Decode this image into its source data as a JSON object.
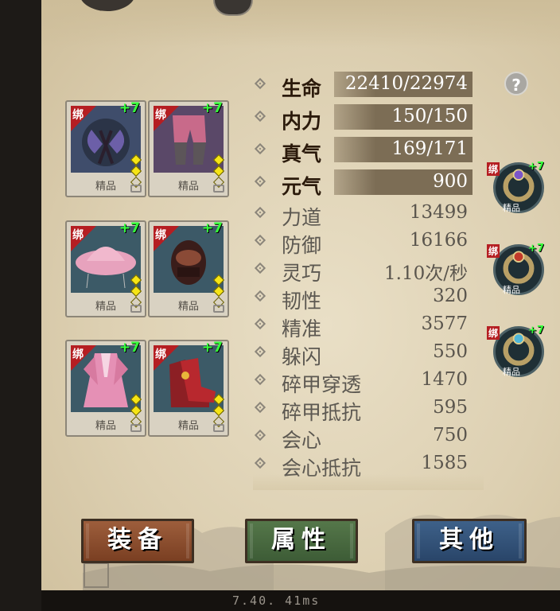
{
  "help_icon": "question-mark-icon",
  "equipment": {
    "bind_label": "绑",
    "slots": [
      {
        "plus": "+7",
        "quality": "精品",
        "item_icon": "twin-axe-weapon-icon",
        "accent": "#3f4d6b"
      },
      {
        "plus": "+7",
        "quality": "精品",
        "item_icon": "pink-trousers-icon",
        "accent": "#5b4a6b"
      },
      {
        "plus": "+7",
        "quality": "精品",
        "item_icon": "pink-straw-hat-icon",
        "accent": "#3c5a67"
      },
      {
        "plus": "+7",
        "quality": "精品",
        "item_icon": "bracer-gauntlet-icon",
        "accent": "#3c5967"
      },
      {
        "plus": "+7",
        "quality": "精品",
        "item_icon": "pink-robe-icon",
        "accent": "#3c5a67"
      },
      {
        "plus": "+7",
        "quality": "精品",
        "item_icon": "red-boots-icon",
        "accent": "#3c5a67"
      }
    ]
  },
  "stats": [
    {
      "name": "生命",
      "value": "22410/22974",
      "highlight": true
    },
    {
      "name": "内力",
      "value": "150/150",
      "highlight": true
    },
    {
      "name": "真气",
      "value": "169/171",
      "highlight": true
    },
    {
      "name": "元气",
      "value": "900",
      "highlight": true
    },
    {
      "name": "力道",
      "value": "13499",
      "highlight": false
    },
    {
      "name": "防御",
      "value": "16166",
      "highlight": false
    },
    {
      "name": "灵巧",
      "value": "1.10次/秒",
      "highlight": false
    },
    {
      "name": "韧性",
      "value": "320",
      "highlight": false
    },
    {
      "name": "精准",
      "value": "3577",
      "highlight": false
    },
    {
      "name": "躲闪",
      "value": "550",
      "highlight": false
    },
    {
      "name": "碎甲穿透",
      "value": "1470",
      "highlight": false
    },
    {
      "name": "碎甲抵抗",
      "value": "595",
      "highlight": false
    },
    {
      "name": "会心",
      "value": "750",
      "highlight": false
    },
    {
      "name": "会心抵抗",
      "value": "1585",
      "highlight": false
    }
  ],
  "accessories": [
    {
      "bind": "绑",
      "plus": "+7",
      "quality": "精品",
      "item_icon": "purple-gem-ring-icon",
      "gem": "#7b55c9"
    },
    {
      "bind": "绑",
      "plus": "+7",
      "quality": "精品",
      "item_icon": "red-gem-ring-icon",
      "gem": "#c23a2a"
    },
    {
      "bind": "绑",
      "plus": "+7",
      "quality": "精品",
      "item_icon": "blue-jade-bracelet-icon",
      "gem": "#4fb7d9"
    }
  ],
  "tabs": {
    "equip": "装备",
    "attributes": "属性",
    "other": "其他"
  },
  "footer_text": "7.40.  41ms"
}
